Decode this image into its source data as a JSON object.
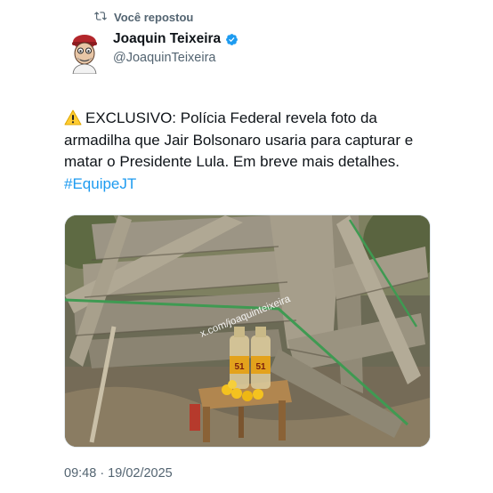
{
  "repost": {
    "label": "Você repostou",
    "icon": "repost-icon"
  },
  "author": {
    "name": "Joaquin Teixeira",
    "handle": "@JoaquinTeixeira",
    "verified_icon": "verified-badge-icon",
    "verified_color": "#1d9bf0"
  },
  "tweet": {
    "warning_icon": "warning-icon",
    "lines": [
      "EXCLUSIVO: Polícia Federal revela foto da",
      "armadilha que Jair Bolsonaro usaria para capturar e",
      "matar o Presidente Lula. Em breve mais detalhes."
    ],
    "hashtag": "#EquipeJT",
    "hashtag_color": "#1d9bf0"
  },
  "media": {
    "watermark": "x.com/joaquinteixeira",
    "bottle_label": "51"
  },
  "timestamp": "09:48 · 19/02/2025"
}
